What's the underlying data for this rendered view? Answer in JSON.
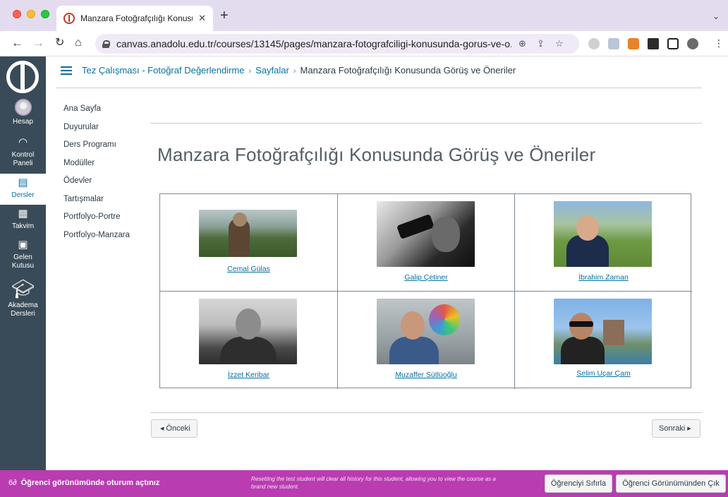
{
  "browser": {
    "tab_title": "Manzara Fotoğrafçılığı Konusun",
    "tab_close": "✕",
    "new_tab": "+",
    "url": "canvas.anadolu.edu.tr/courses/13145/pages/manzara-fotografciligi-konusunda-gorus-ve-o..."
  },
  "global_nav": {
    "items": [
      {
        "label_1": "Hesap",
        "label_2": ""
      },
      {
        "label_1": "Kontrol",
        "label_2": "Paneli"
      },
      {
        "label_1": "Dersler",
        "label_2": ""
      },
      {
        "label_1": "Takvim",
        "label_2": ""
      },
      {
        "label_1": "Gelen",
        "label_2": "Kutusu"
      },
      {
        "label_1": "Akadema",
        "label_2": "Dersleri"
      }
    ]
  },
  "breadcrumb": {
    "course": "Tez Çalışması - Fotoğraf Değerlendirme",
    "section": "Sayfalar",
    "current": "Manzara Fotoğrafçılığı Konusunda Görüş ve Öneriler",
    "separator": "›"
  },
  "course_nav": {
    "items": [
      "Ana Sayfa",
      "Duyurular",
      "Ders Programı",
      "Modüller",
      "Ödevler",
      "Tartışmalar",
      "Portfolyo-Portre",
      "Portfolyo-Manzara"
    ]
  },
  "page": {
    "title": "Manzara Fotoğrafçılığı Konusunda Görüş ve Öneriler",
    "people": [
      {
        "name": "Cemal Gülas"
      },
      {
        "name": "Galip Çetiner"
      },
      {
        "name": "İbrahim Zaman"
      },
      {
        "name": "İzzet Keribar"
      },
      {
        "name": "Muzaffer Sütlüoğlu"
      },
      {
        "name": "Selim Uçar Çam"
      }
    ]
  },
  "pager": {
    "prev_label": "Önceki",
    "next_label": "Sonraki",
    "prev_arrow": "◀",
    "next_arrow": "▶"
  },
  "student_view": {
    "label": "Öğrenci görünümünde oturum açtınız",
    "note": "Resetting the test student will clear all history for this student, allowing you to view the course as a brand new student.",
    "reset_label": "Öğrenciyi Sıfırla",
    "leave_label": "Öğrenci Görünümünden Çık"
  },
  "colors": {
    "nav_bg": "#394b58",
    "link": "#0770a3",
    "student_bar": "#b93cb1"
  }
}
